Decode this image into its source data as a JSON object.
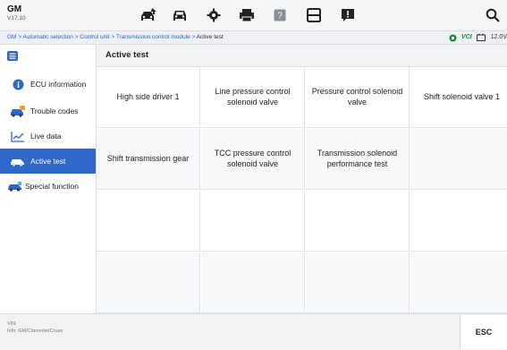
{
  "brand": {
    "make": "GM",
    "version": "V17.10"
  },
  "toolbar": {
    "icons": [
      "home-car-icon",
      "vehicle-icon",
      "settings-gear-icon",
      "print-icon",
      "help-icon",
      "save-icon",
      "message-icon",
      "search-icon"
    ]
  },
  "breadcrumb": {
    "path": "GM > Automatic selection > Control unit > Transmission control module > ",
    "current": "Active test"
  },
  "status": {
    "vci": "VCI",
    "battery": "12.0V"
  },
  "sidebar": {
    "items": [
      {
        "label": "ECU information",
        "icon": "info-icon",
        "active": false
      },
      {
        "label": "Trouble codes",
        "icon": "car-fault-icon",
        "active": false
      },
      {
        "label": "Live data",
        "icon": "line-graph-icon",
        "active": false
      },
      {
        "label": "Active test",
        "icon": "car-test-icon",
        "active": true
      },
      {
        "label": "Special function",
        "icon": "car-function-icon",
        "active": false
      }
    ]
  },
  "main": {
    "title": "Active test",
    "tests": [
      "High side driver 1",
      "Line pressure control solenoid valve",
      "Pressure control solenoid valve",
      "Shift solenoid valve 1",
      "Shift transmission gear",
      "TCC pressure control solenoid valve",
      "Transmission solenoid performance test",
      ""
    ]
  },
  "footer": {
    "vin_label": "VIN:",
    "info": "Info: GM/Chevrolet/Cruze",
    "esc_label": "ESC"
  },
  "colors": {
    "accent": "#2f68c9",
    "vci_green": "#1d8a36",
    "link": "#2a64c8"
  }
}
